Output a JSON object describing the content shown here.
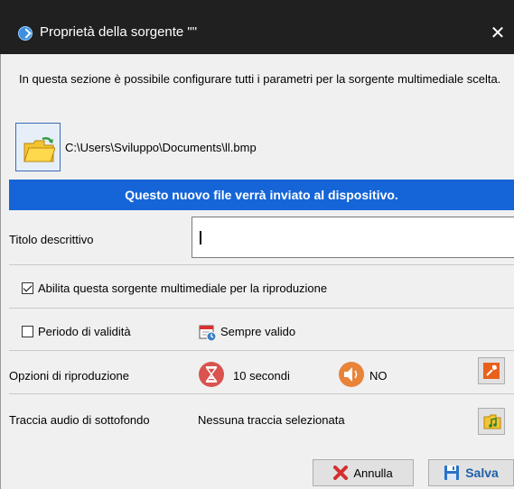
{
  "window": {
    "title": "Proprietà della sorgente \"\"",
    "close_glyph": "✕"
  },
  "description": "In questa sezione è possibile configurare tutti i parametri per la sorgente multimediale scelta.",
  "file": {
    "path": "C:\\Users\\Sviluppo\\Documents\\ll.bmp",
    "icon": "folder-open-icon"
  },
  "info_banner": "Questo nuovo file verrà inviato al dispositivo.",
  "title_field": {
    "label": "Titolo descrittivo",
    "value": ""
  },
  "enable_checkbox": {
    "label": "Abilita questa sorgente multimediale per la riproduzione",
    "checked": true
  },
  "validity": {
    "label": "Periodo di validità",
    "checked": false,
    "value": "Sempre valido",
    "icon": "calendar-clock-icon"
  },
  "playback": {
    "label": "Opzioni di riproduzione",
    "duration": "10 secondi",
    "duration_icon": "hourglass-icon",
    "audio": "NO",
    "audio_icon": "speaker-icon",
    "settings_icon": "wrench-icon"
  },
  "background_audio": {
    "label": "Traccia audio di sottofondo",
    "value": "Nessuna traccia selezionata",
    "icon": "music-folder-icon"
  },
  "buttons": {
    "cancel": "Annulla",
    "save": "Salva"
  },
  "colors": {
    "titlebar": "#202020",
    "banner": "#1565d8",
    "save_text": "#1f5ea8"
  }
}
